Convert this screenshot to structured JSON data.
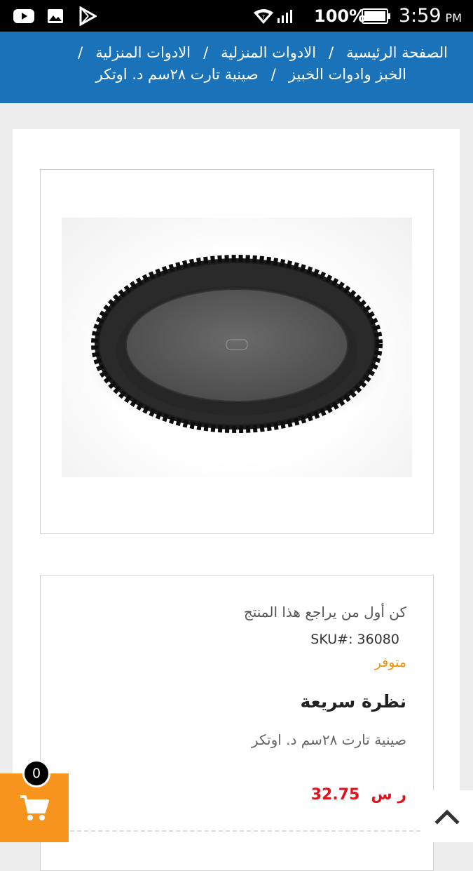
{
  "status_bar": {
    "battery_percent": "100%",
    "time": "3:59",
    "ampm": "PM",
    "icons": [
      "youtube-icon",
      "gallery-icon",
      "play-store-icon",
      "wifi-icon",
      "signal-icon",
      "battery-icon"
    ]
  },
  "breadcrumb": {
    "home": "الصفحة الرئيسية",
    "cat1": "الادوات المنزلية",
    "cat2": "الادوات المنزلية",
    "cat3": "الخبز وادوات الخبيز",
    "current": "صينية تارت ٢٨سم د. اوتكر",
    "separator": "/"
  },
  "product": {
    "image_alt": "tart pan",
    "review_link": "كن أول من يراجع هذا المنتج",
    "sku": "SKU#: 36080",
    "stock": "متوفر",
    "quick_view_title": "نظرة سريعة",
    "name": "صينية تارت ٢٨سم د. اوتكر",
    "currency": "ر س",
    "price": "32.75"
  },
  "cart": {
    "count": "0"
  },
  "colors": {
    "header_blue": "#1a72b9",
    "cart_orange": "#f7941d",
    "stock_orange": "#f39200",
    "price_red": "#e0121b"
  }
}
